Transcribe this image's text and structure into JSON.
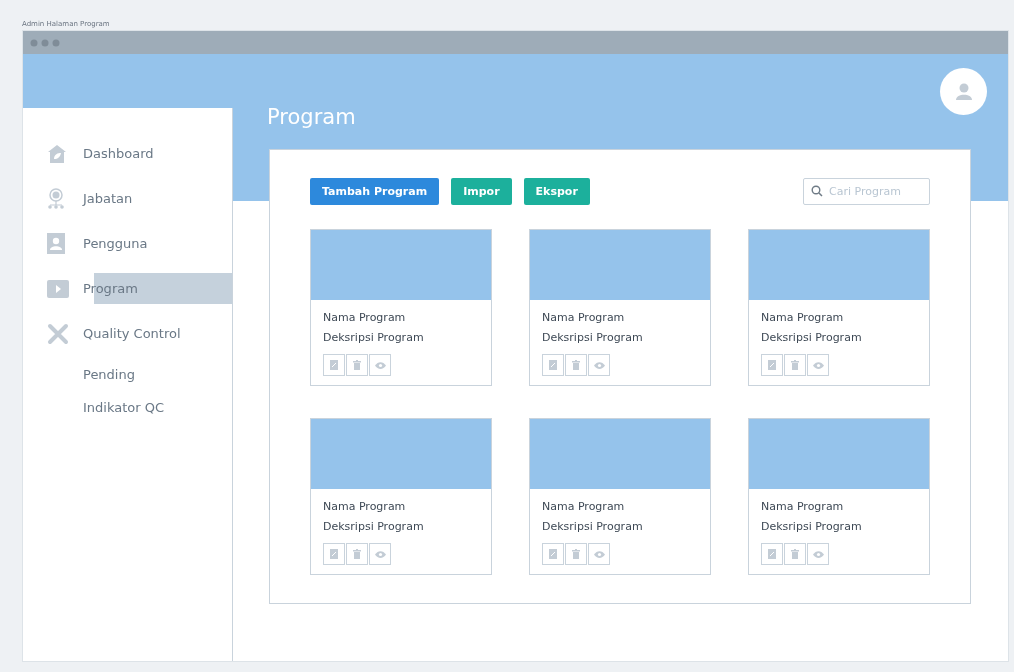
{
  "caption": "Admin Halaman Program",
  "sidebar": {
    "items": [
      {
        "label": "Dashboard",
        "selected": false
      },
      {
        "label": "Jabatan",
        "selected": false
      },
      {
        "label": "Pengguna",
        "selected": false
      },
      {
        "label": "Program",
        "selected": true
      },
      {
        "label": "Quality Control",
        "selected": false,
        "children": [
          {
            "label": "Pending",
            "selected": false
          },
          {
            "label": "Indikator QC",
            "selected": false
          }
        ]
      }
    ]
  },
  "page_title": "Program",
  "buttons": [
    {
      "label": "Tambah Program",
      "kind": "primary"
    },
    {
      "label": "Impor",
      "kind": "secondary"
    },
    {
      "label": "Ekspor",
      "kind": "secondary"
    }
  ],
  "search": {
    "placeholder": "Cari Program"
  },
  "cards": [
    {
      "name": "Nama Program",
      "description": "Deksripsi Program"
    },
    {
      "name": "Nama Program",
      "description": "Deksripsi Program"
    },
    {
      "name": "Nama Program",
      "description": "Deksripsi Program"
    },
    {
      "name": "Nama Program",
      "description": "Deksripsi Program"
    },
    {
      "name": "Nama Program",
      "description": "Deksripsi Program"
    },
    {
      "name": "Nama Program",
      "description": "Deksripsi Program"
    }
  ]
}
